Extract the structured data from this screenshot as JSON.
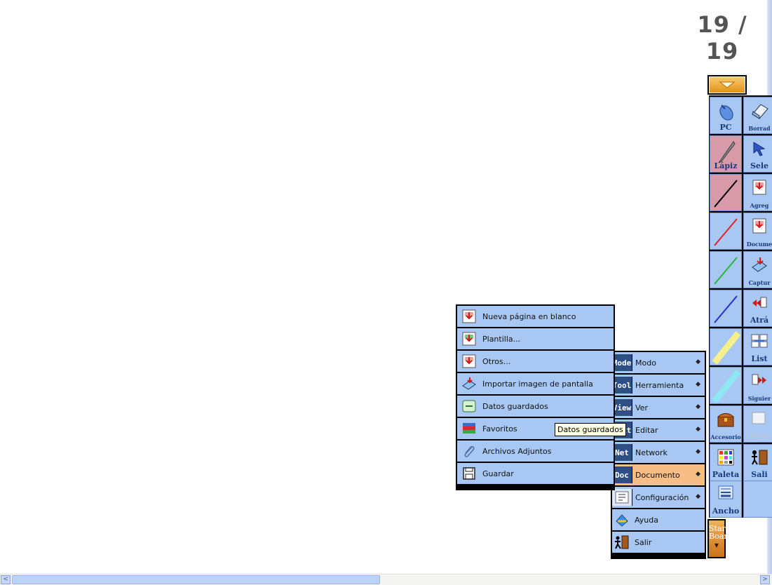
{
  "page_counter": "19 / 19",
  "toolbar": {
    "left": [
      {
        "label": "PC",
        "icon": "mouse-icon"
      },
      {
        "label": "Lápiz",
        "icon": "pencil-icon",
        "selected": true
      },
      {
        "label": "",
        "icon": "black-line-icon",
        "color": "#000000",
        "selected": true
      },
      {
        "label": "",
        "icon": "red-line-icon",
        "color": "#e0202a"
      },
      {
        "label": "",
        "icon": "green-line-icon",
        "color": "#22b83a"
      },
      {
        "label": "",
        "icon": "blue-line-icon",
        "color": "#2030c8"
      },
      {
        "label": "",
        "icon": "yellow-highlighter-icon",
        "color": "#f5f08a"
      },
      {
        "label": "",
        "icon": "cyan-highlighter-icon",
        "color": "#8ee8f4"
      },
      {
        "label": "Accesorio",
        "icon": "treasure-chest-icon"
      },
      {
        "label": "Paleta",
        "icon": "palette-icon"
      },
      {
        "label": "Ancho",
        "icon": "width-lines-icon"
      }
    ],
    "right": [
      {
        "label": "Borrad",
        "icon": "eraser-icon"
      },
      {
        "label": "Sele",
        "icon": "select-arrow-icon"
      },
      {
        "label": "Agreg",
        "icon": "add-page-icon"
      },
      {
        "label": "Docume",
        "icon": "document-icon"
      },
      {
        "label": "Captur",
        "icon": "capture-icon"
      },
      {
        "label": "Atrá",
        "icon": "back-arrow-icon"
      },
      {
        "label": "List",
        "icon": "list-icon"
      },
      {
        "label": "Siguier",
        "icon": "next-arrow-icon"
      },
      {
        "label": "Borr",
        "icon": "clear-icon"
      },
      {
        "label": "Sali",
        "icon": "exit-door-icon"
      }
    ]
  },
  "starboard": {
    "line1": "Star",
    "line2": "Board"
  },
  "main_menu": [
    {
      "tag": "Mode",
      "label": "Modo",
      "arrow": "◆"
    },
    {
      "tag": "Tool",
      "label": "Herramienta",
      "arrow": "◆"
    },
    {
      "tag": "View",
      "label": "Ver",
      "arrow": "◆"
    },
    {
      "tag": "Edit",
      "label": "Editar",
      "arrow": "◆"
    },
    {
      "tag": "Net",
      "label": "Network",
      "arrow": "◆"
    },
    {
      "tag": "Doc",
      "label": "Documento",
      "arrow": "◆",
      "active": true
    },
    {
      "tag": "",
      "label": "Configuración",
      "arrow": "◆",
      "icon": "settings-icon"
    },
    {
      "tag": "",
      "label": "Ayuda",
      "arrow": "",
      "icon": "help-icon"
    },
    {
      "tag": "",
      "label": "Salir",
      "arrow": "",
      "icon": "exit-door-icon"
    }
  ],
  "document_submenu": [
    {
      "label": "Nueva página en blanco",
      "icon": "new-page-icon"
    },
    {
      "label": "Plantilla...",
      "icon": "template-icon"
    },
    {
      "label": "Otros...",
      "icon": "other-pages-icon"
    },
    {
      "label": "Importar imagen de pantalla",
      "icon": "import-screen-icon"
    },
    {
      "label": "Datos guardados",
      "icon": "saved-data-icon"
    },
    {
      "label": "Favoritos",
      "icon": "favorites-icon"
    },
    {
      "label": "Archivos Adjuntos",
      "icon": "paperclip-icon"
    },
    {
      "label": "Guardar",
      "icon": "floppy-disk-icon"
    }
  ],
  "tooltip": "Datos guardados",
  "colors": {
    "menu_bg": "#a9c7f3",
    "menu_active": "#f6bd86",
    "tool_selected": "#d79aa9"
  }
}
